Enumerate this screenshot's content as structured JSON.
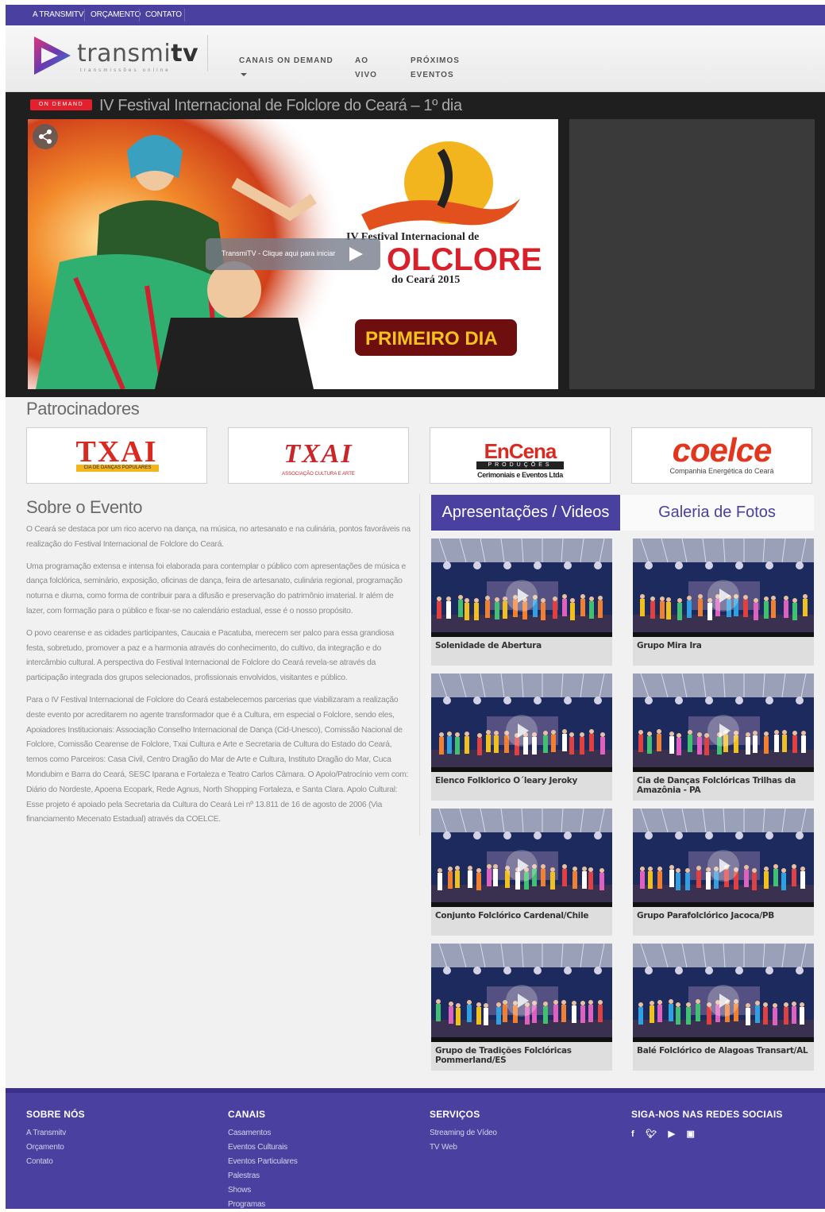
{
  "topnav": [
    "A TRANSMITV",
    "ORÇAMENTO",
    "CONTATO"
  ],
  "logo": {
    "name_light": "transmi",
    "name_bold": "tv",
    "tagline": "transmissões online"
  },
  "mainnav": {
    "canais": "CANAIS ON DEMAND",
    "ao_line1": "AO",
    "ao_line2": "VIVO",
    "prox_line1": "PRÓXIMOS",
    "prox_line2": "EVENTOS"
  },
  "player": {
    "badge": "ON DEMAND",
    "title": "IV Festival Internacional de Folclore do Ceará – 1º dia",
    "play_text": "TransmiTV - Clique aqui para iniciar",
    "poster_line1": "IV Festival Internacional de",
    "poster_line2": "OLCLORE",
    "poster_line3": "do Ceará 2015",
    "poster_button": "PRIMEIRO DIA"
  },
  "sponsors_title": "Patrocinadores",
  "sponsors": [
    {
      "name": "TXAI",
      "sub": "CIA DE DANÇAS POPULARES"
    },
    {
      "name": "TXAI",
      "sub": "ASSOCIAÇÃO CULTURA E ARTE"
    },
    {
      "name": "EnCena",
      "band": "PRODUÇÕES",
      "sub": "Cerimoniais e Eventos Ltda"
    },
    {
      "name": "coelce",
      "sub": "Companhia Energética do Ceará"
    }
  ],
  "about": {
    "title": "Sobre o Evento",
    "paragraphs": [
      "O Ceará se destaca por um rico acervo na dança, na música, no artesanato e na culinária, pontos favoráveis na realização do Festival Internacional de Folclore do Ceará.",
      "Uma programação extensa e intensa foi elaborada para contemplar o público com apresentações de música e dança folclórica, seminário, exposição, oficinas de dança, feira de artesanato, culinária regional, programação noturna e diurna, como forma de contribuir para a difusão e preservação do patrimônio imaterial. Ir além de lazer, com formação para o público e fixar-se no calendário estadual, esse é o nosso propósito.",
      "O povo cearense e as cidades participantes, Caucaia e Pacatuba, merecem ser palco para essa grandiosa festa, sobretudo, promover a paz e a harmonia através do conhecimento, do cultivo, da integração e do intercâmbio cultural. A perspectiva do Festival Internacional de Folclore do Ceará revela-se através da participação integrada dos grupos selecionados, profissionais envolvidos, visitantes e público.",
      "Para o IV Festival Internacional de Folclore do Ceará estabelecemos parcerias que viabilizaram a realização deste evento por acreditarem no agente transformador que é a Cultura, em especial o Folclore, sendo eles, Apoiadores Institucionais: Associação Conselho Internacional de Dança (Cid-Unesco), Comissão Nacional de Folclore, Comissão Cearense de Folclore, Txai Cultura e Arte e Secretaria de Cultura do Estado do Ceará, temos como Parceiros: Casa Civil, Centro Dragão do Mar de Arte e Cultura, Instituto Dragão do Mar, Cuca Mondubim e Barra do Ceará, SESC Iparana e Fortaleza e Teatro Carlos Câmara. O Apolo/Patrocínio vem com: Diário do Nordeste, Apoena Ecopark, Rede Agnus, North Shopping Fortaleza, e Santa Clara. Apolo Cultural: Esse projeto é apoiado pela Secretaria da Cultura do Ceará Lei nº 13.811 de 16 de agosto de 2006 (Via financiamento Mecenato Estadual) através da COELCE."
    ]
  },
  "tabs": {
    "videos": "Apresentações / Videos",
    "fotos": "Galeria de Fotos"
  },
  "videos": [
    "Solenidade de Abertura",
    "Grupo Mira Ira",
    "Elenco Folklorico O´leary Jeroky",
    "Cia de Danças Folclóricas Trilhas da Amazônia - PA",
    "Conjunto Folclórico Cardenal/Chile",
    "Grupo Parafolclórico Jacoca/PB",
    "Grupo de Tradições Folclóricas Pommerland/ES",
    "Balé Folclórico de Alagoas Transart/AL"
  ],
  "footer": {
    "sobre": {
      "title": "SOBRE NÓS",
      "links": [
        "A Transmitv",
        "Orçamento",
        "Contato"
      ]
    },
    "canais": {
      "title": "CANAIS",
      "links": [
        "Casamentos",
        "Eventos Culturais",
        "Eventos Particulares",
        "Palestras",
        "Shows",
        "Programas"
      ]
    },
    "servicos": {
      "title": "SERVIÇOS",
      "links": [
        "Streaming de Vídeo",
        "TV Web"
      ]
    },
    "social": {
      "title": "SIGA-NOS NAS REDES SOCIAIS",
      "icons": [
        "facebook-icon",
        "twitter-icon",
        "youtube-icon",
        "instagram-icon"
      ]
    }
  },
  "colors": {
    "brand": "#4a40a0",
    "badge": "#e2202e",
    "player_bg": "#1f1f1f"
  }
}
